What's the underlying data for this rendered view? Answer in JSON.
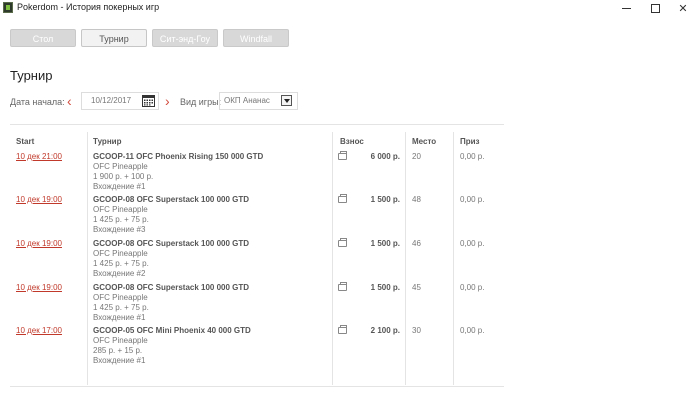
{
  "window": {
    "title": "Pokerdom - История покерных игр"
  },
  "tabs": [
    {
      "label": "Стол"
    },
    {
      "label": "Турнир",
      "active": true
    },
    {
      "label": "Сит-энд-Гоу"
    },
    {
      "label": "Windfall"
    }
  ],
  "page": {
    "title": "Турнир"
  },
  "filters": {
    "date_label": "Дата начала:",
    "date_value": "10/12/2017",
    "game_type_label": "Вид игры:",
    "game_type_value": "ОКП Ананас"
  },
  "table": {
    "headers": {
      "start": "Start",
      "tournament": "Турнир",
      "buyin": "Взнос",
      "place": "Место",
      "prize": "Приз"
    },
    "rows": [
      {
        "start": "10 дек 21:00",
        "name": "GCOOP-11 OFC Phoenix Rising 150 000 GTD",
        "game": "OFC Pineapple",
        "fee": "1 900 р. + 100 р.",
        "entry": "Вхождение #1",
        "buyin": "6 000 р.",
        "place": "20",
        "prize": "0,00 р."
      },
      {
        "start": "10 дек 19:00",
        "name": "GCOOP-08 OFC Superstack 100 000 GTD",
        "game": "OFC Pineapple",
        "fee": "1 425 р. + 75 р.",
        "entry": "Вхождение #3",
        "buyin": "1 500 р.",
        "place": "48",
        "prize": "0,00 р."
      },
      {
        "start": "10 дек 19:00",
        "name": "GCOOP-08 OFC Superstack 100 000 GTD",
        "game": "OFC Pineapple",
        "fee": "1 425 р. + 75 р.",
        "entry": "Вхождение #2",
        "buyin": "1 500 р.",
        "place": "46",
        "prize": "0,00 р."
      },
      {
        "start": "10 дек 19:00",
        "name": "GCOOP-08 OFC Superstack 100 000 GTD",
        "game": "OFC Pineapple",
        "fee": "1 425 р. + 75 р.",
        "entry": "Вхождение #1",
        "buyin": "1 500 р.",
        "place": "45",
        "prize": "0,00 р."
      },
      {
        "start": "10 дек 17:00",
        "name": "GCOOP-05 OFC Mini Phoenix 40 000 GTD",
        "game": "OFC Pineapple",
        "fee": "285 р. + 15 р.",
        "entry": "Вхождение #1",
        "buyin": "2 100 р.",
        "place": "30",
        "prize": "0,00 р."
      }
    ]
  },
  "icons": {
    "app": "pokerdom-app-icon",
    "calendar": "calendar-icon",
    "prev": "chevron-left-icon",
    "next": "chevron-right-icon",
    "dropdown": "chevron-down-icon",
    "buyin": "wallet-icon"
  },
  "colors": {
    "accent": "#c0392b",
    "tab_inactive": "#d8d8d8",
    "tab_active": "#f2f2f2"
  }
}
